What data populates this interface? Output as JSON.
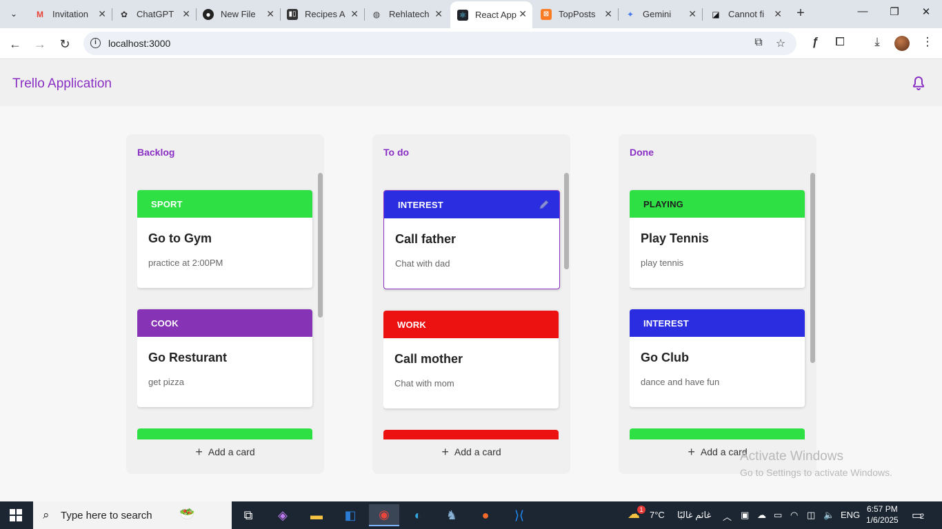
{
  "browser": {
    "tabs": [
      {
        "title": "Invitation",
        "icon": "gmail-icon"
      },
      {
        "title": "ChatGPT",
        "icon": "chatgpt-icon"
      },
      {
        "title": "New File",
        "icon": "github-icon"
      },
      {
        "title": "Recipes A",
        "icon": "trello-icon"
      },
      {
        "title": "Rehlatech",
        "icon": "globe-icon"
      },
      {
        "title": "React App",
        "icon": "react-icon",
        "active": true
      },
      {
        "title": "TopPosts",
        "icon": "xampp-icon"
      },
      {
        "title": "Gemini",
        "icon": "gemini-icon"
      },
      {
        "title": "Cannot fi",
        "icon": "notion-icon"
      }
    ],
    "url": "localhost:3000"
  },
  "app": {
    "title": "Trello Application",
    "accent": "#8a2fc4"
  },
  "board": {
    "columns": [
      {
        "title": "Backlog",
        "cards": [
          {
            "tag": "SPORT",
            "tag_color": "#2ee043",
            "title": "Go to Gym",
            "desc": "practice at 2:00PM"
          },
          {
            "tag": "COOK",
            "tag_color": "#8733b5",
            "title": "Go Resturant",
            "desc": "get pizza"
          }
        ],
        "next_card_color": "#2ee043",
        "add_label": "Add a card"
      },
      {
        "title": "To do",
        "cards": [
          {
            "tag": "INTEREST",
            "tag_color": "#2a2ee0",
            "title": "Call father",
            "desc": "Chat with dad",
            "selected": true
          },
          {
            "tag": "WORK",
            "tag_color": "#ec1212",
            "title": "Call mother",
            "desc": "Chat with mom"
          }
        ],
        "next_card_color": "#ec1212",
        "add_label": "Add a card"
      },
      {
        "title": "Done",
        "cards": [
          {
            "tag": "PLAYING",
            "tag_color": "#2ee043",
            "title": "Play Tennis",
            "desc": "play tennis"
          },
          {
            "tag": "INTEREST",
            "tag_color": "#2a2ee0",
            "title": "Go Club",
            "desc": "dance and have fun"
          }
        ],
        "next_card_color": "#2ee043",
        "add_label": "Add a card"
      }
    ]
  },
  "watermark": {
    "line1": "Activate Windows",
    "line2": "Go to Settings to activate Windows."
  },
  "taskbar": {
    "search_placeholder": "Type here to search",
    "weather": "7°C",
    "weather_desc": "غائم غالبًا",
    "weather_badge": "1",
    "language": "ENG",
    "time": "6:57 PM",
    "date": "1/6/2025",
    "notification_count": "2"
  }
}
